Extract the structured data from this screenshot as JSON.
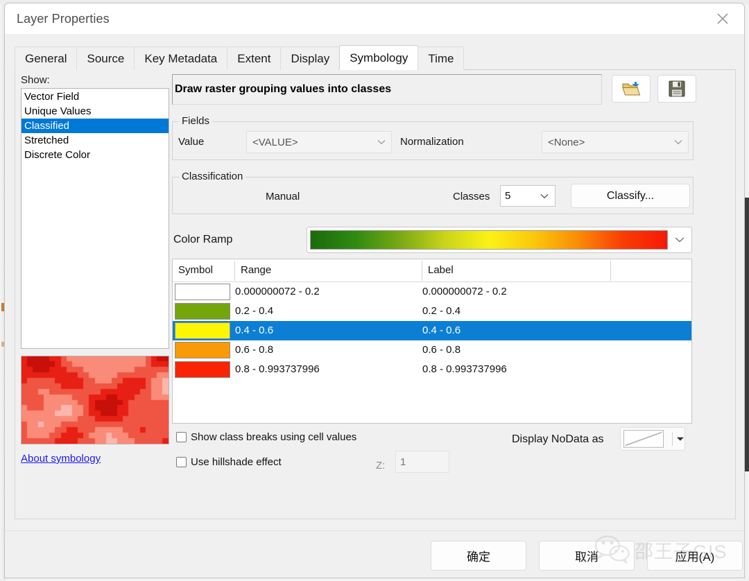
{
  "window": {
    "title": "Layer Properties",
    "close_icon": "close-icon"
  },
  "tabs": [
    {
      "label": "General",
      "active": false
    },
    {
      "label": "Source",
      "active": false
    },
    {
      "label": "Key Metadata",
      "active": false
    },
    {
      "label": "Extent",
      "active": false
    },
    {
      "label": "Display",
      "active": false
    },
    {
      "label": "Symbology",
      "active": true
    },
    {
      "label": "Time",
      "active": false
    }
  ],
  "show": {
    "label": "Show:",
    "items": [
      {
        "label": "Vector Field",
        "selected": false
      },
      {
        "label": "Unique Values",
        "selected": false
      },
      {
        "label": "Classified",
        "selected": true
      },
      {
        "label": "Stretched",
        "selected": false
      },
      {
        "label": "Discrete Color",
        "selected": false
      }
    ]
  },
  "preview": {
    "about_link": "About symbology",
    "palette": [
      "#fbb6ad",
      "#f98b78",
      "#ef5542",
      "#e81f14",
      "#c8100a"
    ]
  },
  "description": {
    "text": "Draw raster grouping values into classes",
    "open_icon": "folder-open-icon",
    "save_icon": "save-disk-icon"
  },
  "fields": {
    "group_title": "Fields",
    "value_label": "Value",
    "value_selected": "<VALUE>",
    "normalization_label": "Normalization",
    "normalization_selected": "<None>"
  },
  "classification": {
    "group_title": "Classification",
    "method": "Manual",
    "classes_label": "Classes",
    "classes_value": "5",
    "classify_button": "Classify..."
  },
  "color_ramp": {
    "label": "Color Ramp",
    "stops": [
      "#1a6b0a",
      "#2f8a12",
      "#79a814",
      "#c9d41a",
      "#fbf215",
      "#fbc80c",
      "#fa8c06",
      "#f93d05",
      "#f61905"
    ]
  },
  "table": {
    "headers": [
      "Symbol",
      "Range",
      "Label"
    ],
    "rows": [
      {
        "color": "#ffffff",
        "range": "0.000000072 - 0.2",
        "label": "0.000000072 - 0.2",
        "selected": false
      },
      {
        "color": "#74a50a",
        "range": "0.2 - 0.4",
        "label": "0.2 - 0.4",
        "selected": false
      },
      {
        "color": "#fcf604",
        "range": "0.4 - 0.6",
        "label": "0.4 - 0.6",
        "selected": true
      },
      {
        "color": "#fa9a06",
        "range": "0.6 - 0.8",
        "label": "0.6 - 0.8",
        "selected": false
      },
      {
        "color": "#f92305",
        "range": "0.8 - 0.993737996",
        "label": "0.8 - 0.993737996",
        "selected": false
      }
    ]
  },
  "options": {
    "show_class_breaks": "Show class breaks using cell values",
    "show_class_breaks_checked": false,
    "use_hillshade": "Use hillshade effect",
    "use_hillshade_checked": false,
    "z_label": "Z:",
    "z_value": "1",
    "nodata_label": "Display NoData as",
    "nodata_swatch": "no-color-swatch"
  },
  "footer": {
    "ok": "确定",
    "cancel": "取消",
    "apply": "应用(A)"
  },
  "watermark": {
    "text": "邵王子GIS",
    "icon": "wechat-logo-icon"
  },
  "colors": {
    "accent": "#0078d7",
    "row_selection": "#0c7fd4",
    "link": "#1a1ae6"
  }
}
